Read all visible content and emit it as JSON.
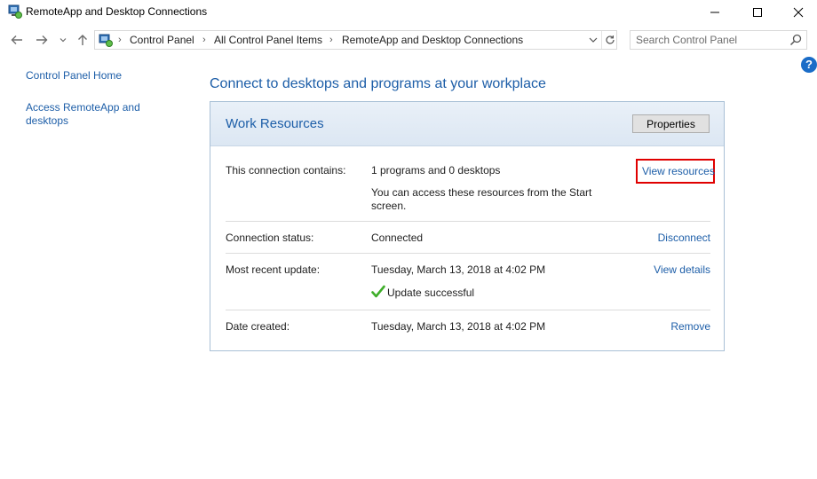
{
  "window": {
    "title": "RemoteApp and Desktop Connections"
  },
  "address": {
    "crumbs": [
      "Control Panel",
      "All Control Panel Items",
      "RemoteApp and Desktop Connections"
    ],
    "search_placeholder": "Search Control Panel"
  },
  "sidebar": {
    "home": "Control Panel Home",
    "access": "Access RemoteApp and desktops"
  },
  "main": {
    "heading": "Connect to desktops and programs at your workplace",
    "panel_title": "Work Resources",
    "properties_label": "Properties",
    "rows": {
      "contains": {
        "label": "This connection contains:",
        "value": "1 programs and 0 desktops",
        "note": "You can access these resources from the Start screen.",
        "action": "View resources"
      },
      "status": {
        "label": "Connection status:",
        "value": "Connected",
        "action": "Disconnect"
      },
      "update": {
        "label": "Most recent update:",
        "value": "Tuesday, March 13, 2018 at 4:02 PM",
        "result": "Update successful",
        "action": "View details"
      },
      "created": {
        "label": "Date created:",
        "value": "Tuesday, March 13, 2018 at 4:02 PM",
        "action": "Remove"
      }
    }
  },
  "colors": {
    "link": "#1d5ea8",
    "highlight": "#e00000",
    "check": "#3fae2a"
  }
}
